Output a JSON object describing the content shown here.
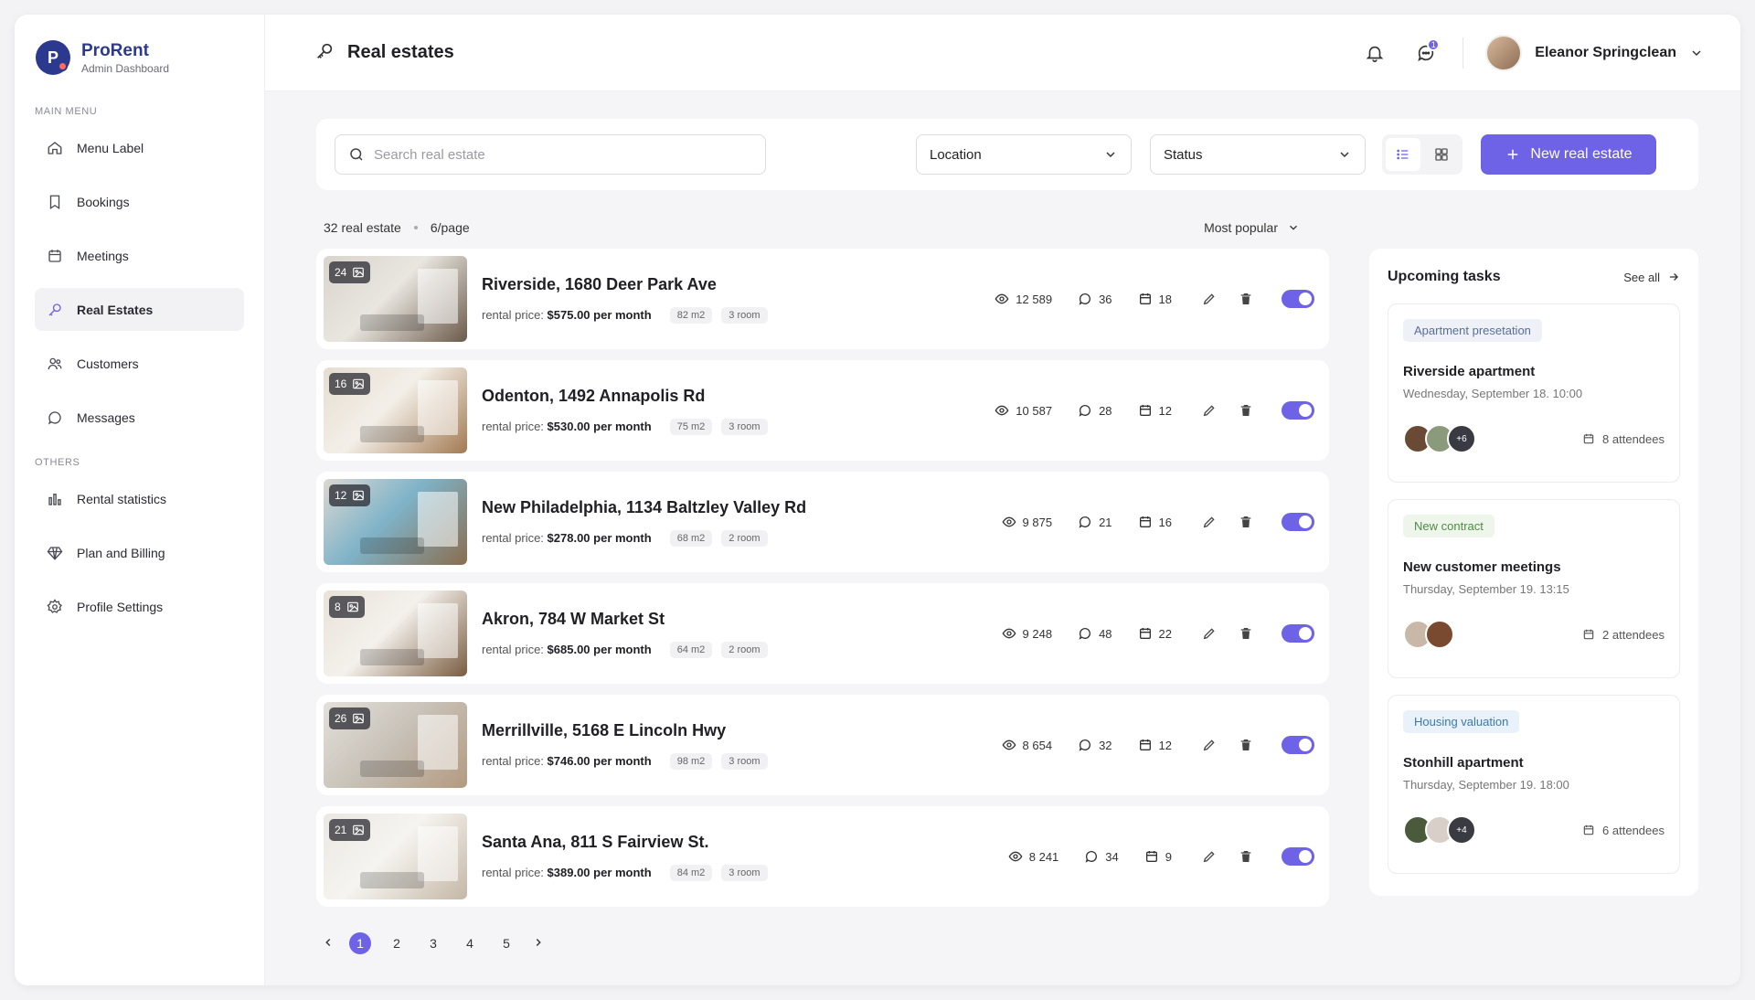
{
  "brand": {
    "name": "ProRent",
    "subtitle": "Admin Dashboard"
  },
  "sidebar": {
    "main_label": "MAIN MENU",
    "main_items": [
      {
        "label": "Menu Label",
        "icon": "home-icon"
      },
      {
        "label": "Bookings",
        "icon": "bookmark-icon"
      },
      {
        "label": "Meetings",
        "icon": "calendar-icon"
      },
      {
        "label": "Real Estates",
        "icon": "key-icon",
        "active": true
      },
      {
        "label": "Customers",
        "icon": "users-icon"
      },
      {
        "label": "Messages",
        "icon": "chat-icon"
      }
    ],
    "others_label": "OTHERS",
    "other_items": [
      {
        "label": "Rental statistics",
        "icon": "bar-chart-icon"
      },
      {
        "label": "Plan and Billing",
        "icon": "diamond-icon"
      },
      {
        "label": "Profile Settings",
        "icon": "gear-icon"
      }
    ]
  },
  "header": {
    "title": "Real estates",
    "message_badge": "1",
    "user_name": "Eleanor Springclean"
  },
  "filters": {
    "search_placeholder": "Search real estate",
    "location": "Location",
    "status": "Status",
    "new_button": "New real estate"
  },
  "meta": {
    "count": "32 real estate",
    "per_page": "6/page",
    "sort": "Most popular"
  },
  "listings": [
    {
      "photos": "24",
      "title": "Riverside, 1680 Deer Park Ave",
      "price_label": "rental price:",
      "price": "$575.00 per month",
      "area": "82 m2",
      "rooms": "3 room",
      "views": "12 589",
      "comments": "36",
      "bookings": "18",
      "img": [
        "#d9d4cc",
        "#6b5a4a",
        "#e9e6e0"
      ]
    },
    {
      "photos": "16",
      "title": "Odenton, 1492 Annapolis Rd",
      "price_label": "rental price:",
      "price": "$530.00 per month",
      "area": "75 m2",
      "rooms": "3 room",
      "views": "10 587",
      "comments": "28",
      "bookings": "12",
      "img": [
        "#e6ddd0",
        "#a37a52",
        "#f3efe8"
      ]
    },
    {
      "photos": "12",
      "title": "New Philadelphia, 1134 Baltzley Valley Rd",
      "price_label": "rental price:",
      "price": "$278.00 per month",
      "area": "68 m2",
      "rooms": "2 room",
      "views": "9 875",
      "comments": "21",
      "bookings": "16",
      "img": [
        "#dcd8d2",
        "#8a6d4f",
        "#7fb3c8"
      ]
    },
    {
      "photos": "8",
      "title": "Akron, 784 W Market St",
      "price_label": "rental price:",
      "price": "$685.00 per month",
      "area": "64 m2",
      "rooms": "2 room",
      "views": "9 248",
      "comments": "48",
      "bookings": "22",
      "img": [
        "#e8e2d8",
        "#7a5c40",
        "#f4f1ec"
      ]
    },
    {
      "photos": "26",
      "title": "Merrillville, 5168 E Lincoln Hwy",
      "price_label": "rental price:",
      "price": "$746.00 per month",
      "area": "98 m2",
      "rooms": "3 room",
      "views": "8 654",
      "comments": "32",
      "bookings": "12",
      "img": [
        "#e4e0da",
        "#b39a80",
        "#c9c3ba"
      ]
    },
    {
      "photos": "21",
      "title": "Santa Ana, 811 S Fairview St.",
      "price_label": "rental price:",
      "price": "$389.00 per month",
      "area": "84 m2",
      "rooms": "3 room",
      "views": "8 241",
      "comments": "34",
      "bookings": "9",
      "img": [
        "#ebe8e3",
        "#c4b7a6",
        "#f6f4f0"
      ]
    }
  ],
  "pagination": {
    "pages": [
      "1",
      "2",
      "3",
      "4",
      "5"
    ],
    "current": "1"
  },
  "tasks": {
    "title": "Upcoming tasks",
    "see_all": "See all",
    "items": [
      {
        "chip": "Apartment presetation",
        "chip_bg": "#eef1f7",
        "chip_color": "#5a6e9a",
        "title": "Riverside apartment",
        "time": "Wednesday, September 18. 10:00",
        "avatars": [
          "#6b4a35",
          "#8a9a7a"
        ],
        "extra": "+6",
        "attendees": "8 attendees"
      },
      {
        "chip": "New contract",
        "chip_bg": "#eef6ec",
        "chip_color": "#4f8a44",
        "title": "New customer meetings",
        "time": "Thursday, September 19. 13:15",
        "avatars": [
          "#c9b8a8",
          "#7a4a30"
        ],
        "extra": "",
        "attendees": "2 attendees"
      },
      {
        "chip": "Housing valuation",
        "chip_bg": "#e9f2fa",
        "chip_color": "#3f78a8",
        "title": "Stonhill apartment",
        "time": "Thursday, September 19. 18:00",
        "avatars": [
          "#4a5a3a",
          "#d8d0c8"
        ],
        "extra": "+4",
        "attendees": "6 attendees"
      }
    ]
  },
  "colors": {
    "accent": "#6e62e6",
    "brand": "#2b3a8f"
  }
}
